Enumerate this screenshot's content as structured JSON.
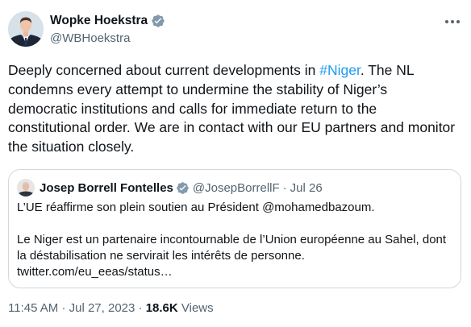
{
  "author": {
    "display_name": "Wopke Hoekstra",
    "handle": "@WBHoekstra",
    "verified_color": "#829aab"
  },
  "tweet": {
    "text_before_hashtag": "Deeply concerned about current developments in ",
    "hashtag": "#Niger",
    "text_after_hashtag": ". The NL condemns every attempt to undermine the stability of Niger’s democratic institutions and calls for immediate return to the constitutional order. We are in contact with our EU partners and monitor the situation closely.",
    "hashtag_color": "#1d9bf0"
  },
  "quoted_tweet": {
    "display_name": "Josep Borrell Fontelles",
    "handle": "@JosepBorrellF",
    "separator": "·",
    "date": "Jul 26",
    "paragraph_1": "L’UE réaffirme son plein soutien au Président @mohamedbazoum.",
    "paragraph_2": "Le Niger est un partenaire incontournable de l’Union européenne au Sahel, dont la déstabilisation ne servirait les intérêts de personne. twitter.com/eu_eeas/status…"
  },
  "meta": {
    "time": "11:45 AM",
    "separator": "·",
    "date": "Jul 27, 2023",
    "separator2": "·",
    "views_count": "18.6K",
    "views_label": "Views"
  },
  "icons": {
    "more": "more-options-icon",
    "verified": "verified-badge-icon"
  }
}
